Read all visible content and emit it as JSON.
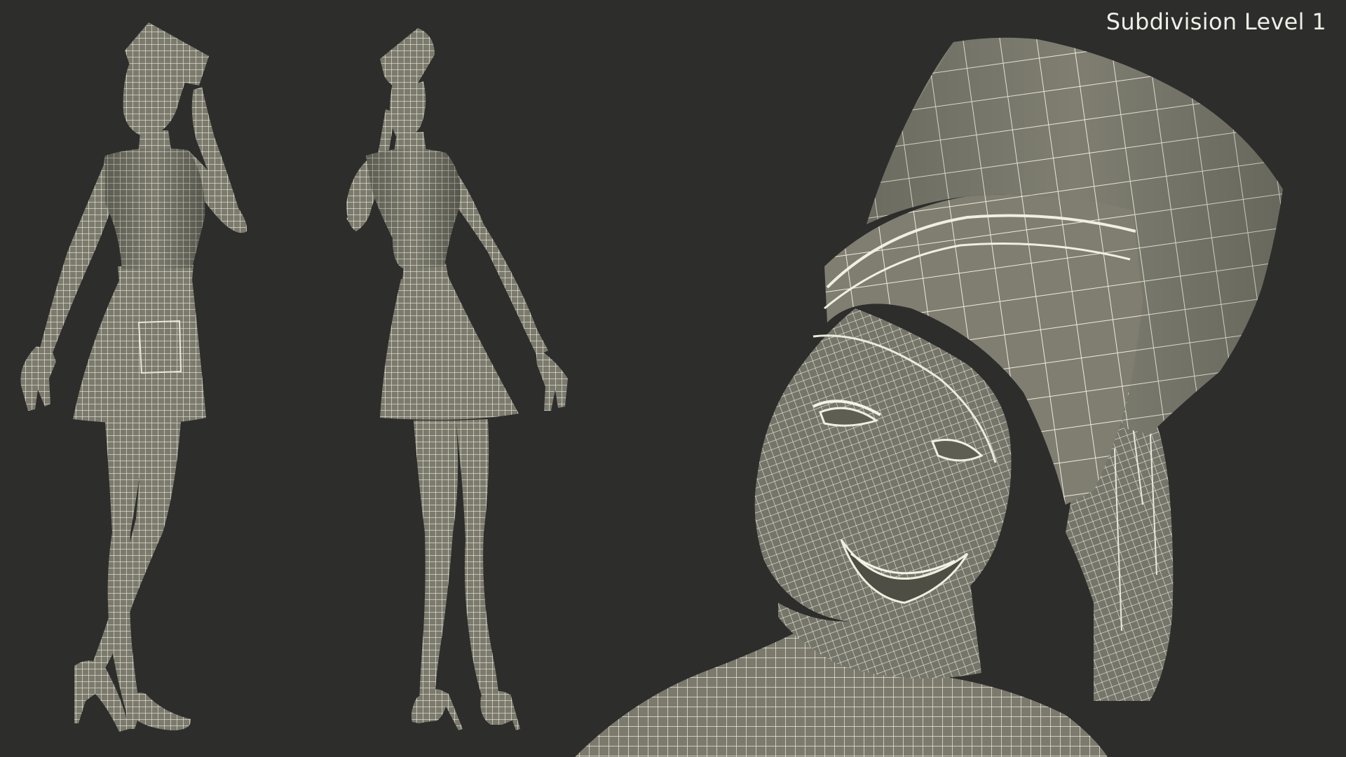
{
  "overlay": {
    "subdivision_label": "Subdivision Level 1"
  },
  "colors": {
    "background": "#2d2d2c",
    "mesh_fill": "#7b7a6d",
    "mesh_dark": "#5f5e53",
    "wire": "#ecebdc",
    "label_text": "#efefe9"
  },
  "views": [
    "front-three-quarter",
    "back-three-quarter",
    "face-close-up"
  ]
}
